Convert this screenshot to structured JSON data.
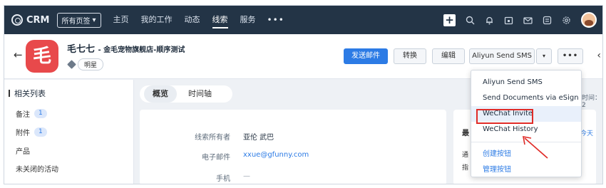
{
  "topbar": {
    "logo_text": "CRM",
    "view_select": "所有页签",
    "nav": [
      "主页",
      "我的工作",
      "动态",
      "线索",
      "服务"
    ],
    "active_nav": "线索",
    "more": "•••"
  },
  "record": {
    "avatar_char": "毛",
    "name": "毛七七",
    "subtitle": "- 金毛宠物旗舰店-顺序测试",
    "tag": "明星"
  },
  "actions": {
    "send_email": "发送邮件",
    "convert": "转换",
    "edit": "编辑",
    "aliyun": "Aliyun Send SMS",
    "more": "•••"
  },
  "left_panel": {
    "title": "相关列表",
    "items": [
      {
        "label": "备注",
        "count": "1"
      },
      {
        "label": "附件",
        "count": "1"
      },
      {
        "label": "产品",
        "count": ""
      },
      {
        "label": "未关闭的活动",
        "count": ""
      }
    ]
  },
  "tabs": [
    "概览",
    "时间轴"
  ],
  "fields": [
    {
      "label": "线索所有者",
      "value": "亚伦 武巴"
    },
    {
      "label": "电子邮件",
      "value": "xxue@gfunny.com"
    },
    {
      "label": "手机",
      "value": "—"
    }
  ],
  "side": {
    "title_part": "最",
    "right_frag": "时间：2",
    "today": "今天",
    "line1": "通",
    "line2": "指"
  },
  "dropdown": {
    "items": [
      "Aliyun Send SMS",
      "Send Documents via eSign",
      "WeChat Invite",
      "WeChat History",
      "创建按钮",
      "管理按钮"
    ]
  }
}
